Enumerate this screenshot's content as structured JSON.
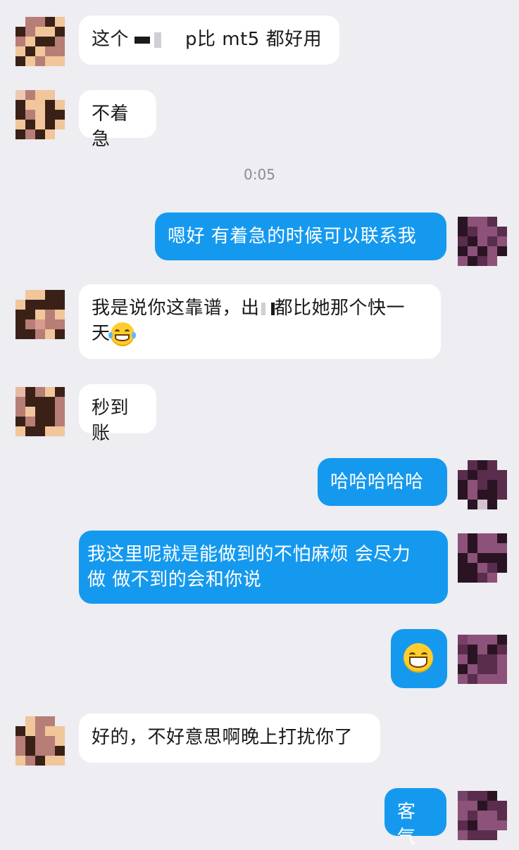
{
  "messages": [
    {
      "from": "them",
      "text_parts": [
        "这个",
        "",
        "p比 mt5 都好用"
      ]
    },
    {
      "from": "them",
      "text": "不着急"
    },
    {
      "from": "me",
      "text": "嗯好 有着急的时候可以联系我"
    },
    {
      "from": "them",
      "text_parts": [
        "我是说你这靠谱，出",
        "",
        "都比她那个快一",
        "天"
      ],
      "emoji": "laugh-tears-emoji"
    },
    {
      "from": "them",
      "text": "秒到账"
    },
    {
      "from": "me",
      "text": "哈哈哈哈哈"
    },
    {
      "from": "me",
      "lines": [
        "我这里呢就是能做到的不怕麻烦 会尽力",
        "做 做不到的会和你说"
      ]
    },
    {
      "from": "me",
      "emoji": "grinning-emoji"
    },
    {
      "from": "them",
      "text": "好的，不好意思啊晚上打扰你了"
    },
    {
      "from": "me",
      "text": "客气"
    }
  ],
  "timestamp": "0:05",
  "colors": {
    "outgoing": "#1599ee",
    "incoming": "#ffffff",
    "background": "#ededf2"
  }
}
